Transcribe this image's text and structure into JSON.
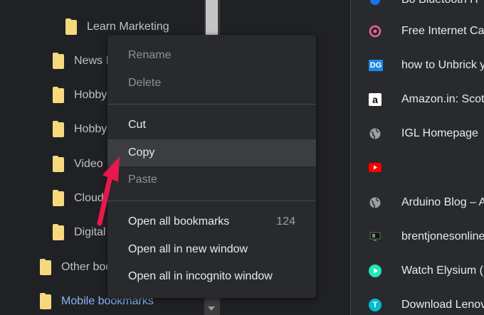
{
  "sidebar": {
    "items": [
      {
        "label": "Learn Marketing"
      },
      {
        "label": "News I"
      },
      {
        "label": "Hobby"
      },
      {
        "label": "Hobby"
      },
      {
        "label": "Video"
      },
      {
        "label": "Cloud"
      },
      {
        "label": "Digital"
      },
      {
        "label": "Other boo"
      },
      {
        "label": "Mobile bookmarks"
      }
    ]
  },
  "bookmarks": [
    {
      "icon": "bluetooth-icon",
      "title": "Bo Bluetooth H"
    },
    {
      "icon": "target-icon",
      "title": "Free Internet Call"
    },
    {
      "icon": "dg-icon",
      "title": "how to Unbrick y",
      "icon_text": "DG"
    },
    {
      "icon": "amazon-icon",
      "title": "Amazon.in: Scote",
      "icon_text": "a"
    },
    {
      "icon": "globe-icon",
      "title": "IGL Homepage"
    },
    {
      "icon": "youtube-icon",
      "title": ""
    },
    {
      "icon": "globe-icon",
      "title": "Arduino Blog – A"
    },
    {
      "icon": "monitor-icon",
      "title": "brentjonesonline"
    },
    {
      "icon": "play-icon",
      "title": "Watch Elysium (M"
    },
    {
      "icon": "lenovo-icon",
      "title": "Download Lenovo",
      "icon_text": "T"
    }
  ],
  "menu": {
    "rename": "Rename",
    "delete": "Delete",
    "cut": "Cut",
    "copy": "Copy",
    "paste": "Paste",
    "open_all": "Open all bookmarks",
    "open_all_count": "124",
    "open_new_window": "Open all in new window",
    "open_incognito": "Open all in incognito window"
  },
  "colors": {
    "background": "#202124",
    "menu_bg": "#292a2d",
    "folder": "#f6d97c",
    "link_blue": "#8ab4f8",
    "arrow_red": "#e8194b"
  }
}
